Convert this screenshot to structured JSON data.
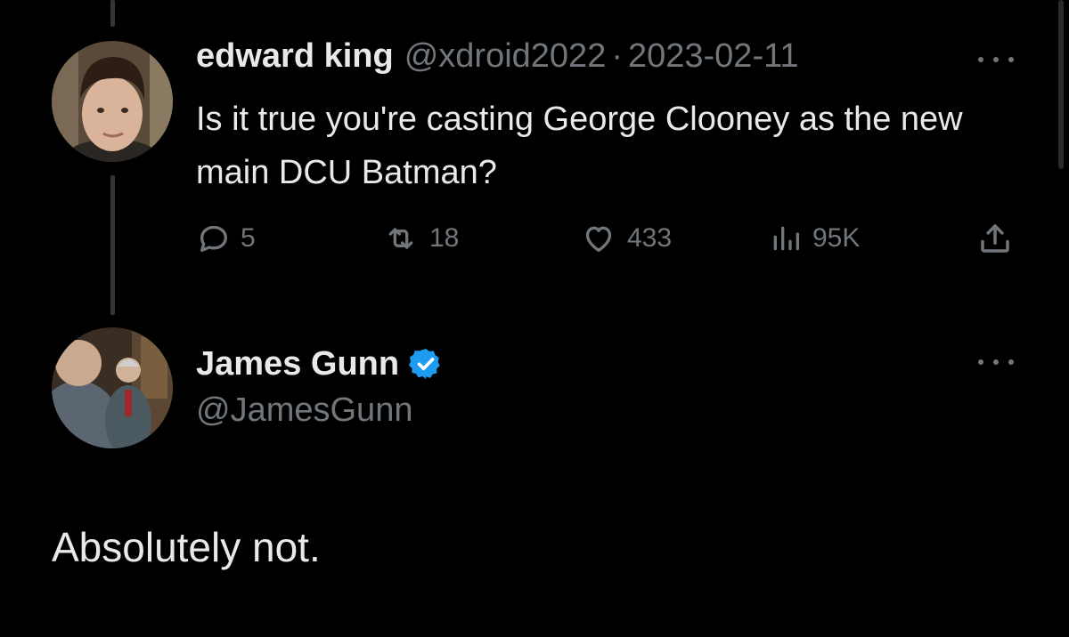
{
  "original_tweet": {
    "author_name": "edward king",
    "author_handle": "@xdroid2022",
    "separator": "·",
    "date": "2023-02-11",
    "text": "Is it true you're casting George Clooney as the new main DCU Batman?",
    "actions": {
      "replies": "5",
      "retweets": "18",
      "likes": "433",
      "views": "95K"
    },
    "icons": {
      "reply": "reply-icon",
      "retweet": "retweet-icon",
      "like": "heart-icon",
      "views": "views-icon",
      "share": "share-icon",
      "more": "more-icon"
    }
  },
  "reply_tweet": {
    "author_name": "James Gunn",
    "author_handle": "@JamesGunn",
    "verified": true,
    "text": "Absolutely not."
  },
  "colors": {
    "background": "#000000",
    "text_primary": "#e7e9ea",
    "text_secondary": "#71767b",
    "verified_blue": "#1d9bf0"
  }
}
